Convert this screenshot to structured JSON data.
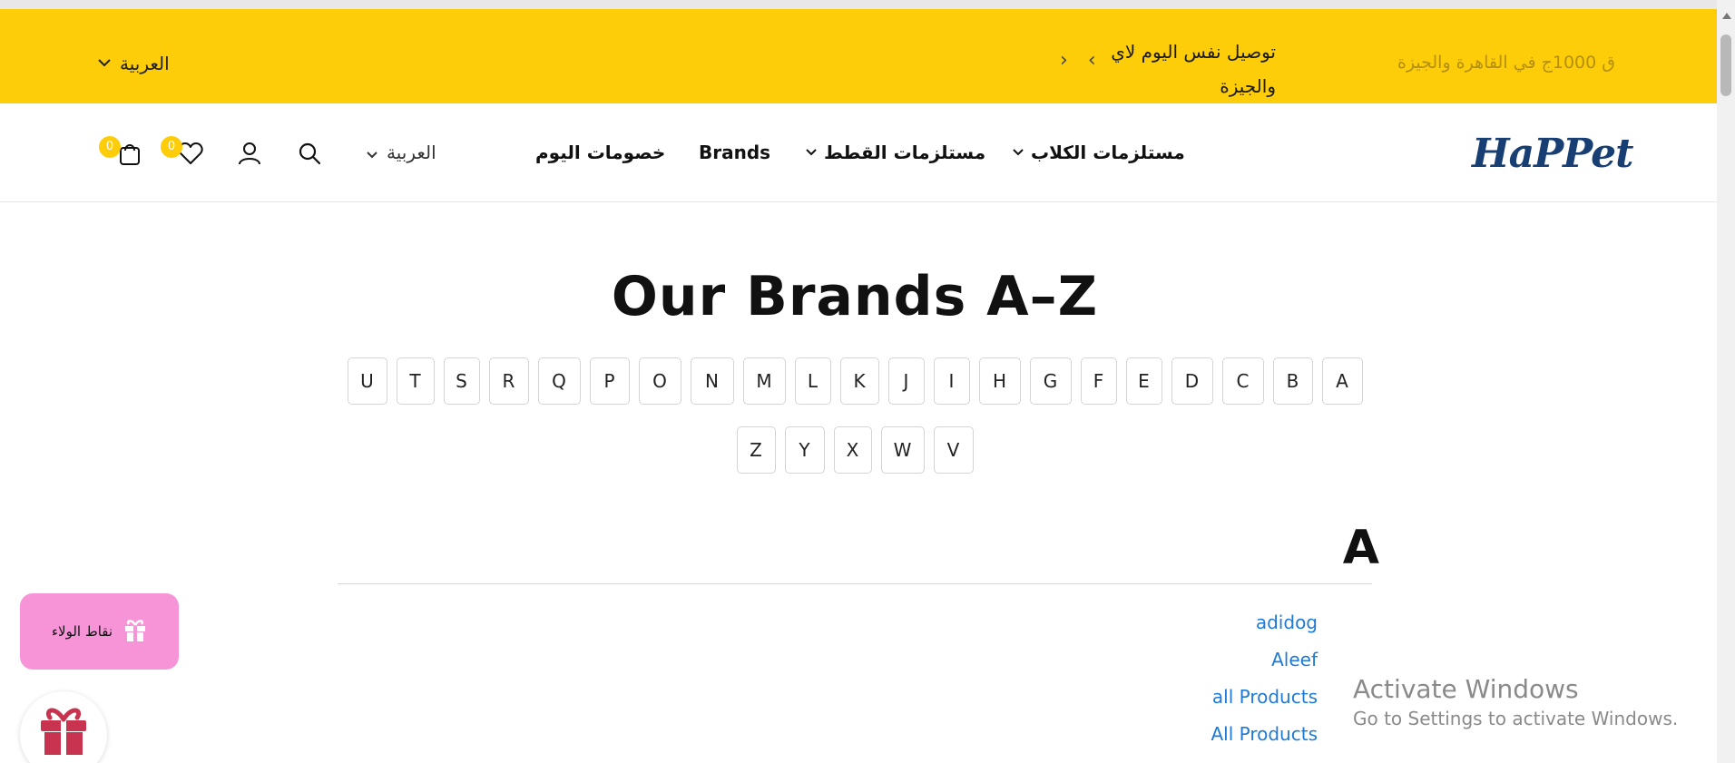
{
  "announcement": {
    "message": "توصيل نفس اليوم لاي والجيزة",
    "faded_message": "ق 1000ج في القاهرة والجيزة",
    "language": "العربية",
    "prev_arrow": "‹",
    "next_arrow": "›"
  },
  "header": {
    "logo": "HaPPet",
    "nav": {
      "dogs": "مستلزمات الكلاب",
      "cats": "مستلزمات القطط",
      "brands": "Brands",
      "deals": "خصومات اليوم"
    },
    "language": "العربية",
    "wishlist_count": "0",
    "cart_count": "0"
  },
  "page": {
    "title": "Our Brands A–Z",
    "letters": [
      "A",
      "B",
      "C",
      "D",
      "E",
      "F",
      "G",
      "H",
      "I",
      "J",
      "K",
      "L",
      "M",
      "N",
      "O",
      "P",
      "Q",
      "R",
      "S",
      "T",
      "U",
      "V",
      "W",
      "X",
      "Y",
      "Z"
    ],
    "section_letter": "A",
    "brands": [
      "adidog",
      "Aleef",
      "all Products",
      "All Products"
    ]
  },
  "loyalty": {
    "label": "نقاط الولاء"
  },
  "watermark": {
    "line1": "Activate Windows",
    "line2": "Go to Settings to activate Windows."
  },
  "colors": {
    "announce_bg": "#fdcd0a",
    "link": "#1e7ad6",
    "loyalty_bg": "#f794d8",
    "gift": "#c8344f",
    "logo": "#173f73"
  }
}
